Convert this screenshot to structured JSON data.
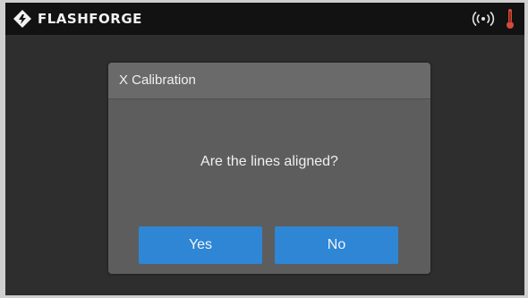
{
  "header": {
    "brand": "FLASHFORGE",
    "logo_icon": "flashforge-logo-icon",
    "status_icons": [
      "wifi-icon",
      "thermometer-icon"
    ]
  },
  "dialog": {
    "title": "X Calibration",
    "message": "Are the lines aligned?",
    "yes_label": "Yes",
    "no_label": "No"
  },
  "colors": {
    "topbar": "#121212",
    "background": "#2e2e2e",
    "dialog": "#5d5d5d",
    "dialog_header": "#6a6a6a",
    "button": "#2f86d4",
    "thermometer": "#c0392b"
  }
}
